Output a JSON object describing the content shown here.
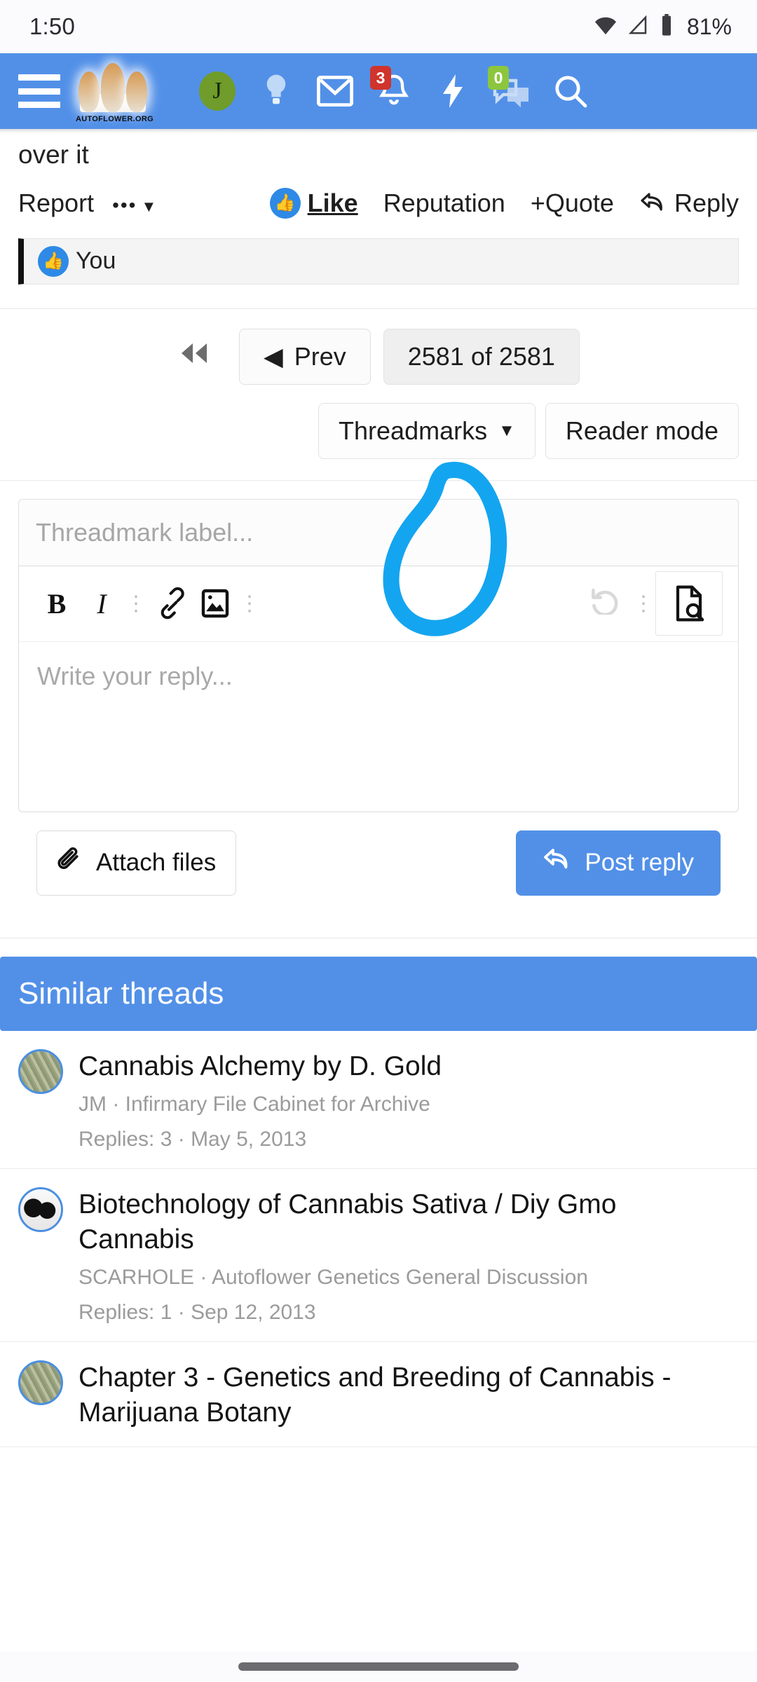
{
  "status_bar": {
    "time": "1:50",
    "battery_percent": "81%",
    "icons": [
      "wifi-icon",
      "signal-icon",
      "battery-icon"
    ]
  },
  "header": {
    "menu_icon": "hamburger-menu-icon",
    "logo_text": "AUTOFLOWER.ORG",
    "brand_color": "#5290e8",
    "avatar_initial": "J",
    "nav": [
      {
        "name": "user-avatar",
        "label": "J"
      },
      {
        "name": "lightbulb-icon",
        "label": ""
      },
      {
        "name": "inbox-icon",
        "label": ""
      },
      {
        "name": "alerts-bell-icon",
        "label": "",
        "badge": "3",
        "badge_color": "#d0342c"
      },
      {
        "name": "bolt-icon",
        "label": ""
      },
      {
        "name": "conversations-icon",
        "label": "",
        "badge": "0",
        "badge_color": "#8cc63e"
      },
      {
        "name": "search-icon",
        "label": ""
      }
    ]
  },
  "post": {
    "trailing_text": "over it",
    "actions": {
      "report": "Report",
      "more_dots": "•••",
      "like": "Like",
      "reputation": "Reputation",
      "quote": "Quote",
      "quote_plus": "+",
      "reply": "Reply"
    },
    "likes_row": {
      "text": "You",
      "icon": "thumbs-up-icon"
    }
  },
  "pagination": {
    "first_icon": "first-page-icon",
    "prev_label": "Prev",
    "prev_arrow": "◀",
    "current_label": "2581 of 2581",
    "current_page": 2581,
    "total_pages": 2581
  },
  "mode_bar": {
    "threadmarks_label": "Threadmarks",
    "threadmarks_caret": "▼",
    "reader_mode_label": "Reader mode"
  },
  "editor": {
    "threadmark_placeholder": "Threadmark label...",
    "body_placeholder": "Write your reply...",
    "toolbar": [
      {
        "name": "bold-button",
        "glyph": "B"
      },
      {
        "name": "italic-button",
        "glyph": "I"
      },
      {
        "name": "text-options-overflow-icon",
        "glyph": "⋮"
      },
      {
        "name": "insert-link-button",
        "glyph": "link"
      },
      {
        "name": "insert-image-button",
        "glyph": "image"
      },
      {
        "name": "insert-overflow-icon",
        "glyph": "⋮"
      },
      {
        "name": "undo-button",
        "glyph": "↺"
      },
      {
        "name": "toolbar-overflow-icon",
        "glyph": "⋮"
      },
      {
        "name": "preview-button",
        "glyph": "document-search"
      }
    ],
    "attach_label": "Attach files",
    "attach_icon": "paperclip-icon",
    "post_label": "Post reply",
    "post_icon": "reply-arrow-icon",
    "annotation": {
      "shape": "hand-drawn-circle",
      "color": "#14a5f0",
      "targets": "preview-button"
    }
  },
  "similar_threads": {
    "heading": "Similar threads",
    "items": [
      {
        "title": "Cannabis Alchemy by D. Gold",
        "meta": "JM · Infirmary File Cabinet for Archive",
        "replies": "Replies: 3 · May 5, 2013",
        "avatar": "leaf-photo-avatar"
      },
      {
        "title": "Biotechnology of Cannabis Sativa / Diy Gmo Cannabis",
        "meta": "SCARHOLE · Autoflower Genetics General Discussion",
        "replies": "Replies: 1 · Sep 12, 2013",
        "avatar": "faces-photo-avatar"
      },
      {
        "title": "Chapter 3 - Genetics and Breeding of Cannabis - Marijuana Botany",
        "meta": "",
        "replies": "",
        "avatar": "leaf-photo-avatar"
      }
    ]
  }
}
